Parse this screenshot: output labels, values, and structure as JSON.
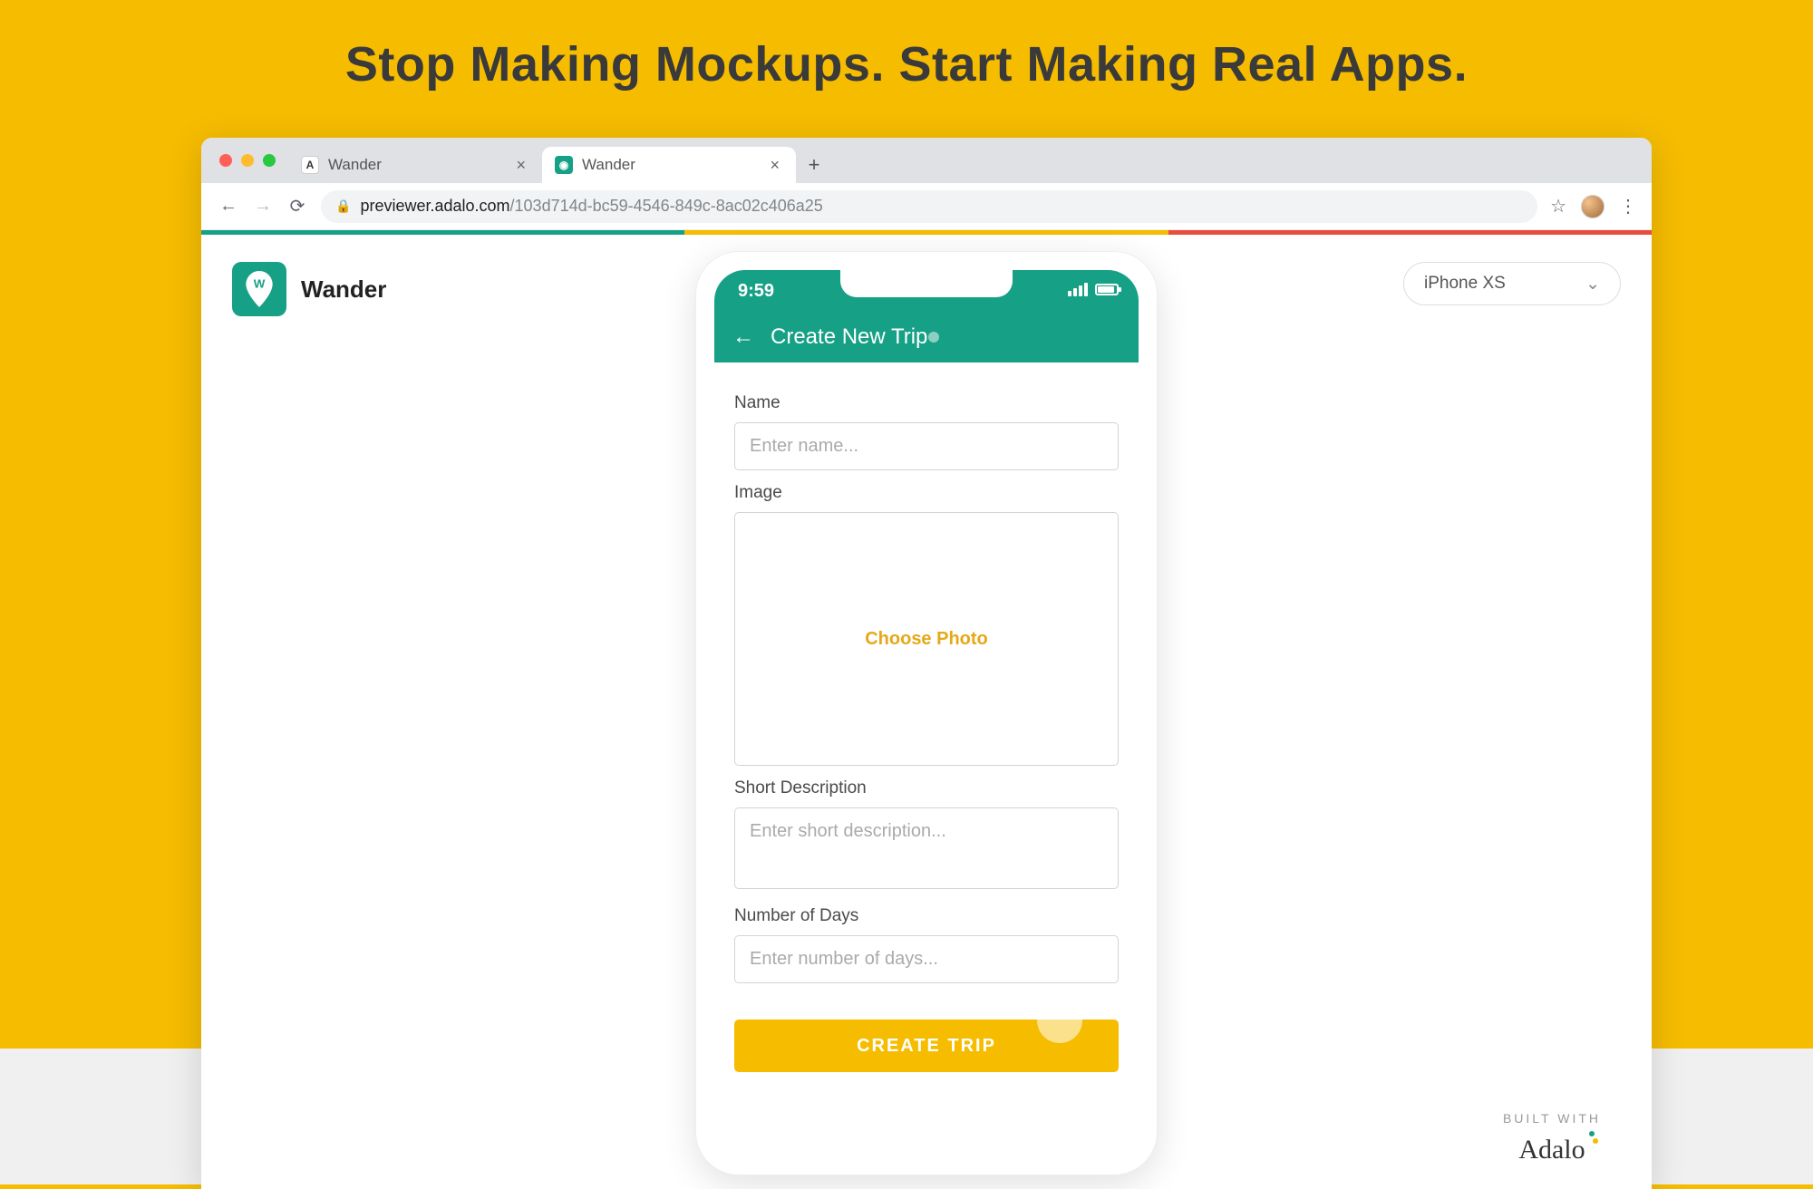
{
  "headline": "Stop Making Mockups. Start Making Real Apps.",
  "browser": {
    "tabs": [
      {
        "title": "Wander",
        "active": false,
        "favicon_bg": "#ffffff",
        "favicon_color": "#333333",
        "favicon_letter": "A"
      },
      {
        "title": "Wander",
        "active": true,
        "favicon_bg": "#16a085",
        "favicon_color": "#ffffff",
        "favicon_letter": "◉"
      }
    ],
    "url_host": "previewer.adalo.com",
    "url_path": "/103d714d-bc59-4546-849c-8ac02c406a25"
  },
  "accent_colors": [
    "#16a085",
    "#f5bc00",
    "#e74c3c"
  ],
  "app": {
    "name": "Wander",
    "brand_color": "#16a085"
  },
  "device_selector": {
    "selected": "iPhone XS"
  },
  "phone": {
    "time": "9:59",
    "screen_title": "Create New Trip",
    "form": {
      "name_label": "Name",
      "name_placeholder": "Enter name...",
      "image_label": "Image",
      "image_button": "Choose Photo",
      "desc_label": "Short Description",
      "desc_placeholder": "Enter short description...",
      "days_label": "Number of Days",
      "days_placeholder": "Enter number of days...",
      "submit_label": "CREATE TRIP"
    }
  },
  "built_with": {
    "label": "BUILT WITH",
    "brand": "Adalo"
  }
}
